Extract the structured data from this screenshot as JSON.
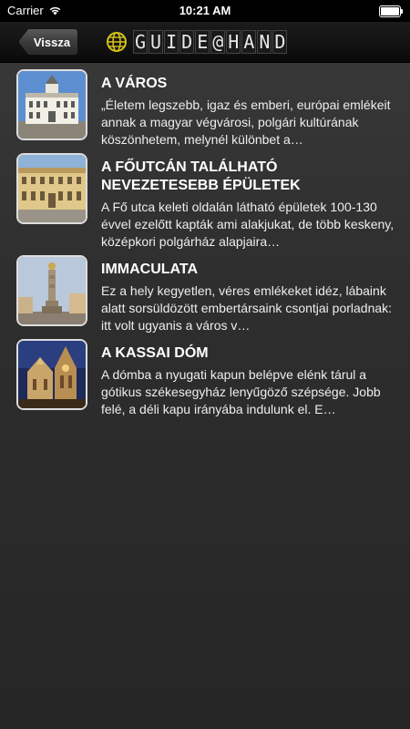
{
  "status_bar": {
    "carrier": "Carrier",
    "time": "10:21 AM",
    "wifi_icon": "wifi-icon",
    "battery_icon": "battery-icon"
  },
  "nav": {
    "back_label": "Vissza",
    "logo_icon": "globe-logo-icon",
    "logo_text": [
      "G",
      "U",
      "I",
      "D",
      "E",
      "@",
      "H",
      "A",
      "N",
      "D"
    ]
  },
  "items": [
    {
      "title": "A VÁROS",
      "description": "„Életem legszebb, igaz és emberi, európai emlékeit annak a magyar végvárosi, polgári kultúrának köszönhetem, melynél különbet a…",
      "image": "city-hall-thumbnail"
    },
    {
      "title": "A FŐUTCÁN TALÁLHATÓ NEVEZETESEBB ÉPÜLETEK",
      "description": "A Fő utca keleti oldalán látható épületek 100-130 évvel ezelőtt kapták ami alakjukat, de több keskeny, középkori polgárház alapjaira…",
      "image": "main-street-buildings-thumbnail"
    },
    {
      "title": "IMMACULATA",
      "description": "Ez a hely kegyetlen, véres emlékeket idéz, lábaink alatt sorsüldözött embertársaink csontjai porladnak: itt volt ugyanis a város v…",
      "image": "plague-column-thumbnail"
    },
    {
      "title": "A KASSAI DÓM",
      "description": "A dómba a nyugati kapun belépve elénk tárul a gótikus székesegyház lenyűgöző szépsége. Jobb felé, a déli kapu irányába indulunk el. E…",
      "image": "gothic-cathedral-thumbnail"
    }
  ],
  "colors": {
    "background": "#2e2e2e",
    "nav_background": "#0a0a0a",
    "text": "#ffffff"
  }
}
